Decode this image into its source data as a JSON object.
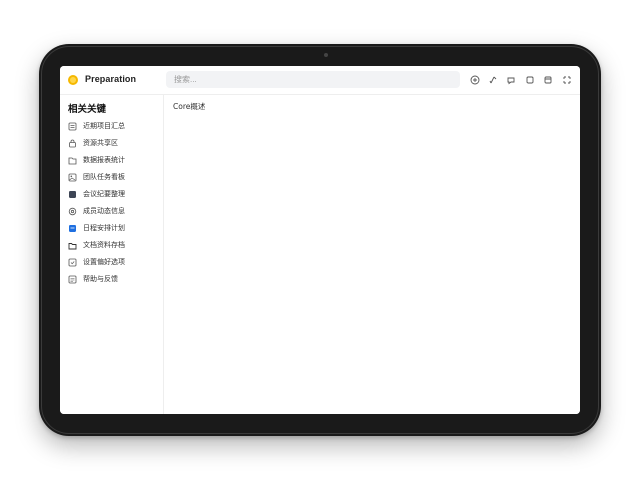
{
  "app": {
    "title": "Preparation"
  },
  "search": {
    "placeholder": "搜索..."
  },
  "toolbar": {
    "icons": [
      "add-icon",
      "share-icon",
      "comment-icon",
      "layout-icon",
      "window-icon",
      "settings-icon"
    ]
  },
  "sidebar": {
    "heading": "相关关键",
    "items": [
      {
        "label": "近期项目汇总",
        "icon": "document-icon"
      },
      {
        "label": "资源共享区",
        "icon": "lock-icon"
      },
      {
        "label": "数据报表统计",
        "icon": "folder-icon"
      },
      {
        "label": "团队任务看板",
        "icon": "image-icon"
      },
      {
        "label": "会议纪要整理",
        "icon": "dark-square-icon",
        "color": "#3d4555"
      },
      {
        "label": "成员动态信息",
        "icon": "gear-icon"
      },
      {
        "label": "日程安排计划",
        "icon": "calendar-icon",
        "color": "#1e6fe0"
      },
      {
        "label": "文档资料存档",
        "icon": "files-icon"
      },
      {
        "label": "设置偏好选项",
        "icon": "checkbox-icon"
      },
      {
        "label": "帮助与反馈",
        "icon": "clipboard-icon"
      }
    ]
  },
  "main": {
    "title": "Core概述"
  }
}
